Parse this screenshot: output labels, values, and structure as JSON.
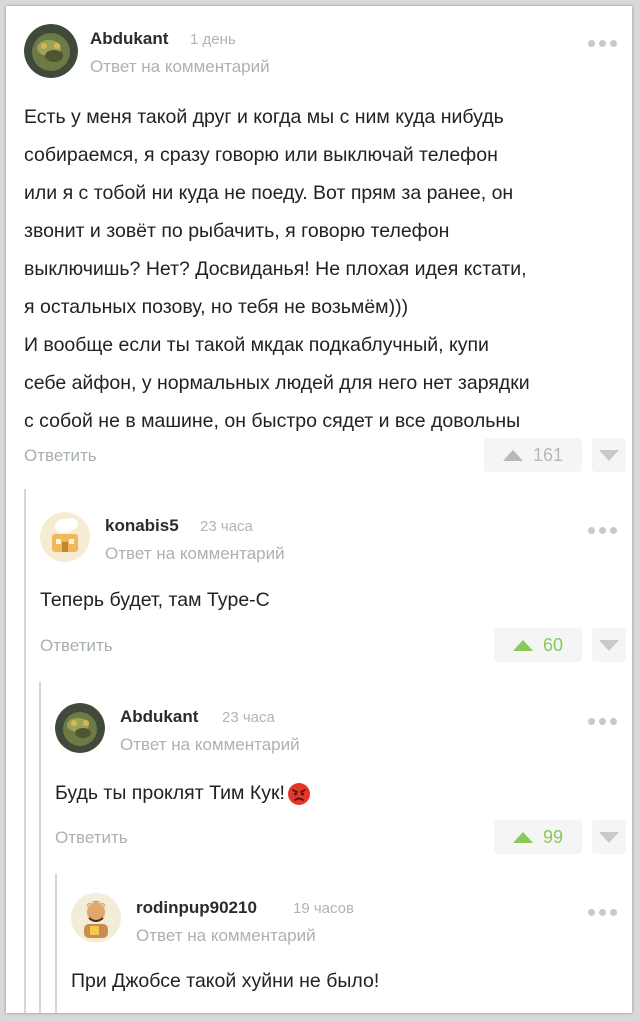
{
  "common": {
    "reply_to_label": "Ответ на комментарий",
    "reply_button": "Ответить"
  },
  "comments": [
    {
      "username": "Abdukant",
      "time": "1 день",
      "lines": [
        "Есть у меня такой друг и когда мы с ним куда нибудь",
        "собираемся, я сразу говорю или выключай телефон",
        "или я с тобой ни куда не поеду. Вот прям за ранее, он",
        "звонит и зовёт по рыбачить, я говорю телефон",
        "выключишь? Нет? Досвиданья! Не плохая идея кстати,",
        "я остальных позову, но тебя не возьмём)))",
        "И вообще если ты такой мкдак подкаблучный, купи",
        "себе айфон, у нормальных людей для него нет зарядки",
        "с собой не в машине, он быстро сядет и все довольны"
      ],
      "rating": "161",
      "rating_color": "#b8b8b8"
    },
    {
      "username": "konabis5",
      "time": "23 часа",
      "lines": [
        "Теперь будет, там Type-C"
      ],
      "rating": "60",
      "rating_color": "#8ac858"
    },
    {
      "username": "Abdukant",
      "time": "23 часа",
      "lines": [
        "Будь ты проклят Тим Кук!"
      ],
      "emoji": "angry-face-emoji",
      "rating": "99",
      "rating_color": "#8ac858"
    },
    {
      "username": "rodinpup90210",
      "time": "19 часов",
      "lines": [
        "При Джобсе такой хуйни не было!"
      ]
    }
  ]
}
